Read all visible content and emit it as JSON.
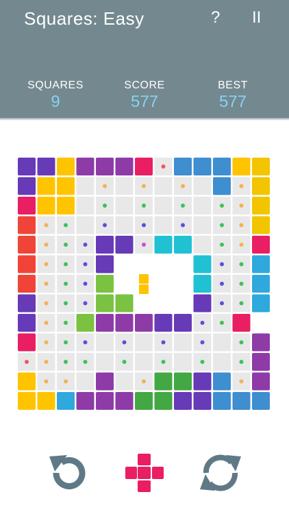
{
  "header": {
    "title": "Squares: Easy",
    "help_label": "?",
    "pause_label": "II"
  },
  "stats": {
    "squares_label": "SQUARES",
    "squares_value": "9",
    "score_label": "SCORE",
    "score_value": "577",
    "best_label": "BEST",
    "best_value": "577"
  },
  "colors": {
    "header_bg": "#74888f",
    "stat_value": "#86d3f0",
    "empty_cell": "#e8e8e8",
    "control_icon": "#5f7a86",
    "piece": "#e91e63"
  },
  "palette": {
    "P": "#673ab7",
    "M": "#8e3ba8",
    "Y": "#ffc400",
    "G": "#f2c500",
    "K": "#e91e63",
    "R": "#f04438",
    "B": "#3e8ed0",
    "L": "#2fa8de",
    "C": "#20c1d3",
    "N": "#7cc242",
    "D": "#43a843",
    "o": "#f5b155",
    "g": "#3ec15b",
    "b": "#5b4fe0",
    "r": "#f05565",
    "m": "#c94fd6"
  },
  "board": {
    "rows": [
      "PPYMMMKrBBBYG",
      "PYY.o.o.o.BoG",
      "KYY.g.g.g.goG",
      "Rog.b.b.b.goG",
      "RogbPPmCC.goK",
      "RogbP    CbgL",
      "RogbN    CbgL",
      "PogbNN   PbgL",
      "PogNMMMPPbgK",
      "Kogb.b.b.b.gM",
      "rogg.g.g.g.gM",
      "Yoo.M.oDDPBoM",
      "YYLMMMDDPPBBB"
    ]
  },
  "current_piece": {
    "color": "#ffc400",
    "cells": [
      [
        0,
        0
      ],
      [
        0,
        1
      ]
    ]
  },
  "controls": {
    "undo": "undo-icon",
    "next_piece": "cross-piece-icon",
    "restart": "restart-icon"
  }
}
